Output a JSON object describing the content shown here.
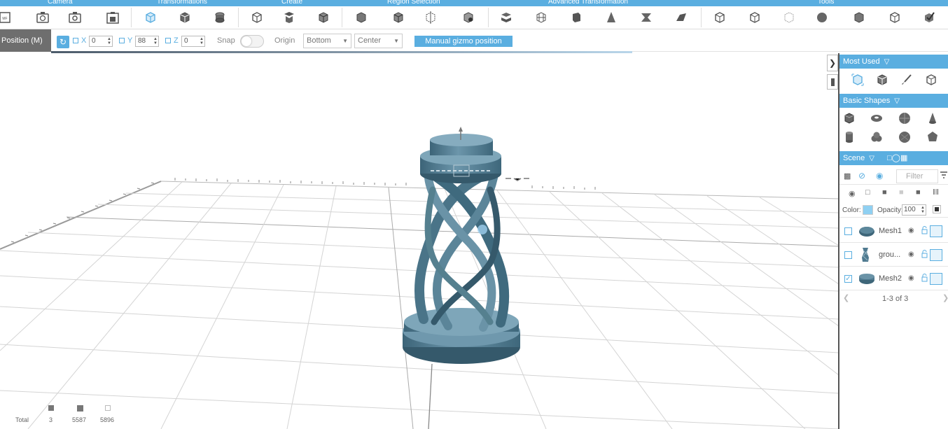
{
  "ribbon": {
    "groups": [
      "Camera",
      "Transformations",
      "Create",
      "Region Selection",
      "Advanced Transformation",
      "Tools"
    ],
    "icons": [
      "mesh-file-icon",
      "camera-reset-icon",
      "camera-snapshot-icon",
      "camera-save-icon",
      "move-gizmo-icon",
      "scale-cube-icon",
      "rotate-cube-icon",
      "create-box-icon",
      "create-cylinder-icon",
      "create-shape-icon",
      "region-box-icon",
      "region-cube-icon",
      "region-gizmo-icon",
      "region-paint-icon",
      "adv-stack-icon",
      "adv-grid-icon",
      "adv-split-icon",
      "adv-cone-icon",
      "adv-twist-icon",
      "adv-slab-icon",
      "tool-box-icon",
      "tool-cube-icon",
      "tool-wire-icon",
      "tool-sphere-icon",
      "tool-shield-icon",
      "tool-check-icon"
    ]
  },
  "toolbar": {
    "mode_label": "Position (M)",
    "x_label": "X",
    "x_value": "0",
    "y_label": "Y",
    "y_value": "88",
    "z_label": "Z",
    "z_value": "0",
    "snap_label": "Snap",
    "origin_label": "Origin",
    "origin_vertical": "Bottom",
    "origin_horizontal": "Center",
    "manual_gizmo_label": "Manual gizmo position"
  },
  "panel": {
    "most_used_title": "Most Used",
    "most_used_icons": [
      "move-icon",
      "cube-icon",
      "brush-icon",
      "box-outline-icon"
    ],
    "basic_shapes_title": "Basic Shapes",
    "basic_shapes_icons": [
      "box-shape-icon",
      "torus-shape-icon",
      "sphere-shape-icon",
      "cone-shape-icon",
      "cylinder-shape-icon",
      "knot-shape-icon",
      "geosphere-shape-icon",
      "polyhedron-shape-icon"
    ],
    "scene_title": "Scene",
    "filter_placeholder": "Filter",
    "color_label": "Color:",
    "color_value": "#8fd0f2",
    "opacity_label": "Opacity:",
    "opacity_value": "100",
    "items": [
      {
        "name": "Mesh1",
        "checked": false
      },
      {
        "name": "grou...",
        "checked": false
      },
      {
        "name": "Mesh2",
        "checked": true
      }
    ],
    "pager_text": "1-3 of 3"
  },
  "stats": {
    "total_label": "Total",
    "objects": "3",
    "vertices": "5587",
    "faces": "5896"
  },
  "colors": {
    "accent": "#5aaee0",
    "model": "#4f7a90"
  }
}
